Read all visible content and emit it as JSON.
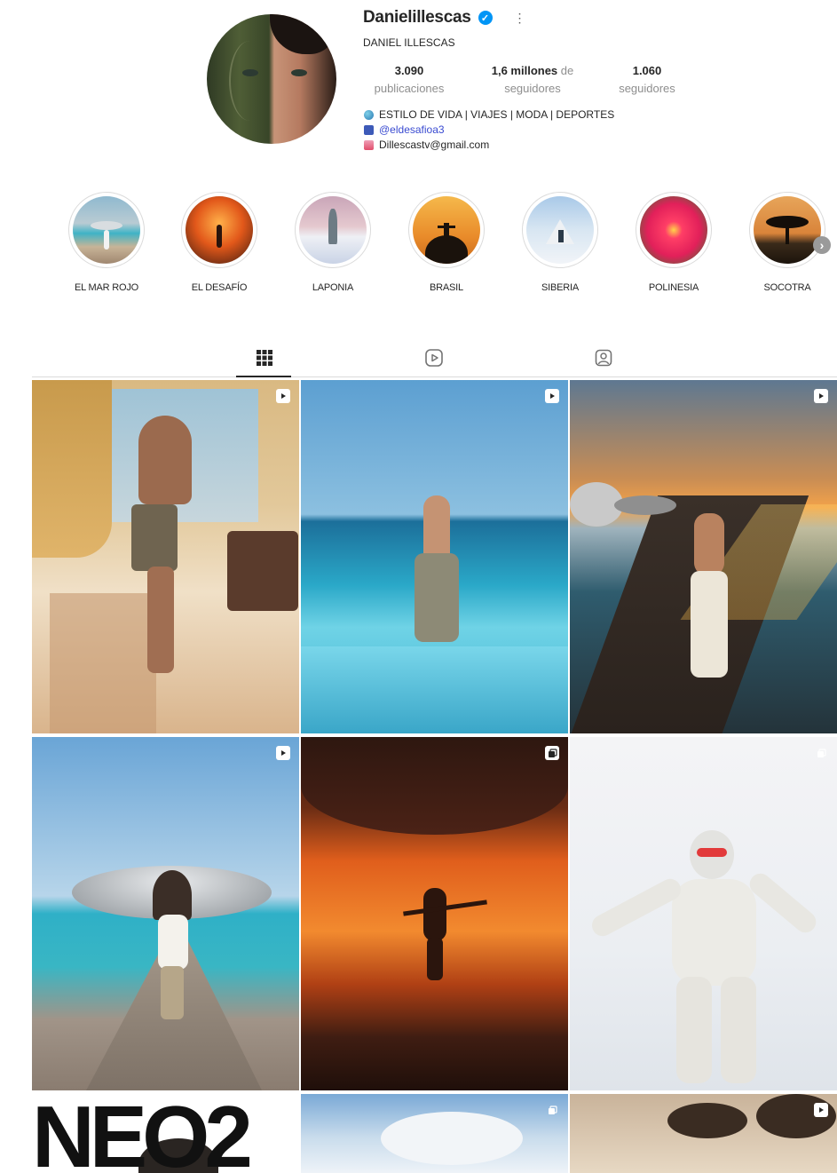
{
  "profile": {
    "username": "Danielillescas",
    "full_name": "DANIEL ILLESCAS",
    "stats": {
      "posts_count": "3.090",
      "posts_label": "publicaciones",
      "followers_count": "1,6 millones",
      "followers_of": "de",
      "followers_label": "seguidores",
      "following_count": "1.060",
      "following_label": "seguidores"
    },
    "bio": {
      "line1": "ESTILO DE VIDA | VIAJES | MODA | DEPORTES",
      "line2": "@eldesafioa3",
      "line3": "Dillescastv@gmail.com"
    }
  },
  "highlights": [
    {
      "label": "EL MAR ROJO"
    },
    {
      "label": "EL DESAFÍO"
    },
    {
      "label": "LAPONIA"
    },
    {
      "label": "BRASIL"
    },
    {
      "label": "SIBERIA"
    },
    {
      "label": "POLINESIA"
    },
    {
      "label": "SOCOTRA"
    }
  ],
  "tabs": [
    {
      "name": "posts-grid",
      "icon": "grid-icon",
      "active": true
    },
    {
      "name": "reels",
      "icon": "reels-icon",
      "active": false
    },
    {
      "name": "tagged",
      "icon": "tagged-icon",
      "active": false
    }
  ],
  "posts": [
    {
      "type": "reel",
      "icon": "play-icon"
    },
    {
      "type": "reel",
      "icon": "play-icon"
    },
    {
      "type": "reel",
      "icon": "play-icon"
    },
    {
      "type": "reel",
      "icon": "play-icon"
    },
    {
      "type": "carousel",
      "icon": "carousel-icon"
    },
    {
      "type": "carousel",
      "icon": "carousel-icon"
    },
    {
      "type": "image",
      "text": "NEO2"
    },
    {
      "type": "carousel",
      "icon": "carousel-icon"
    },
    {
      "type": "reel",
      "icon": "play-icon"
    }
  ],
  "colors": {
    "verified": "#0095f6",
    "link": "#3a4bd1",
    "secondary_text": "#8e8e8e",
    "divider": "#dbdbdb"
  }
}
